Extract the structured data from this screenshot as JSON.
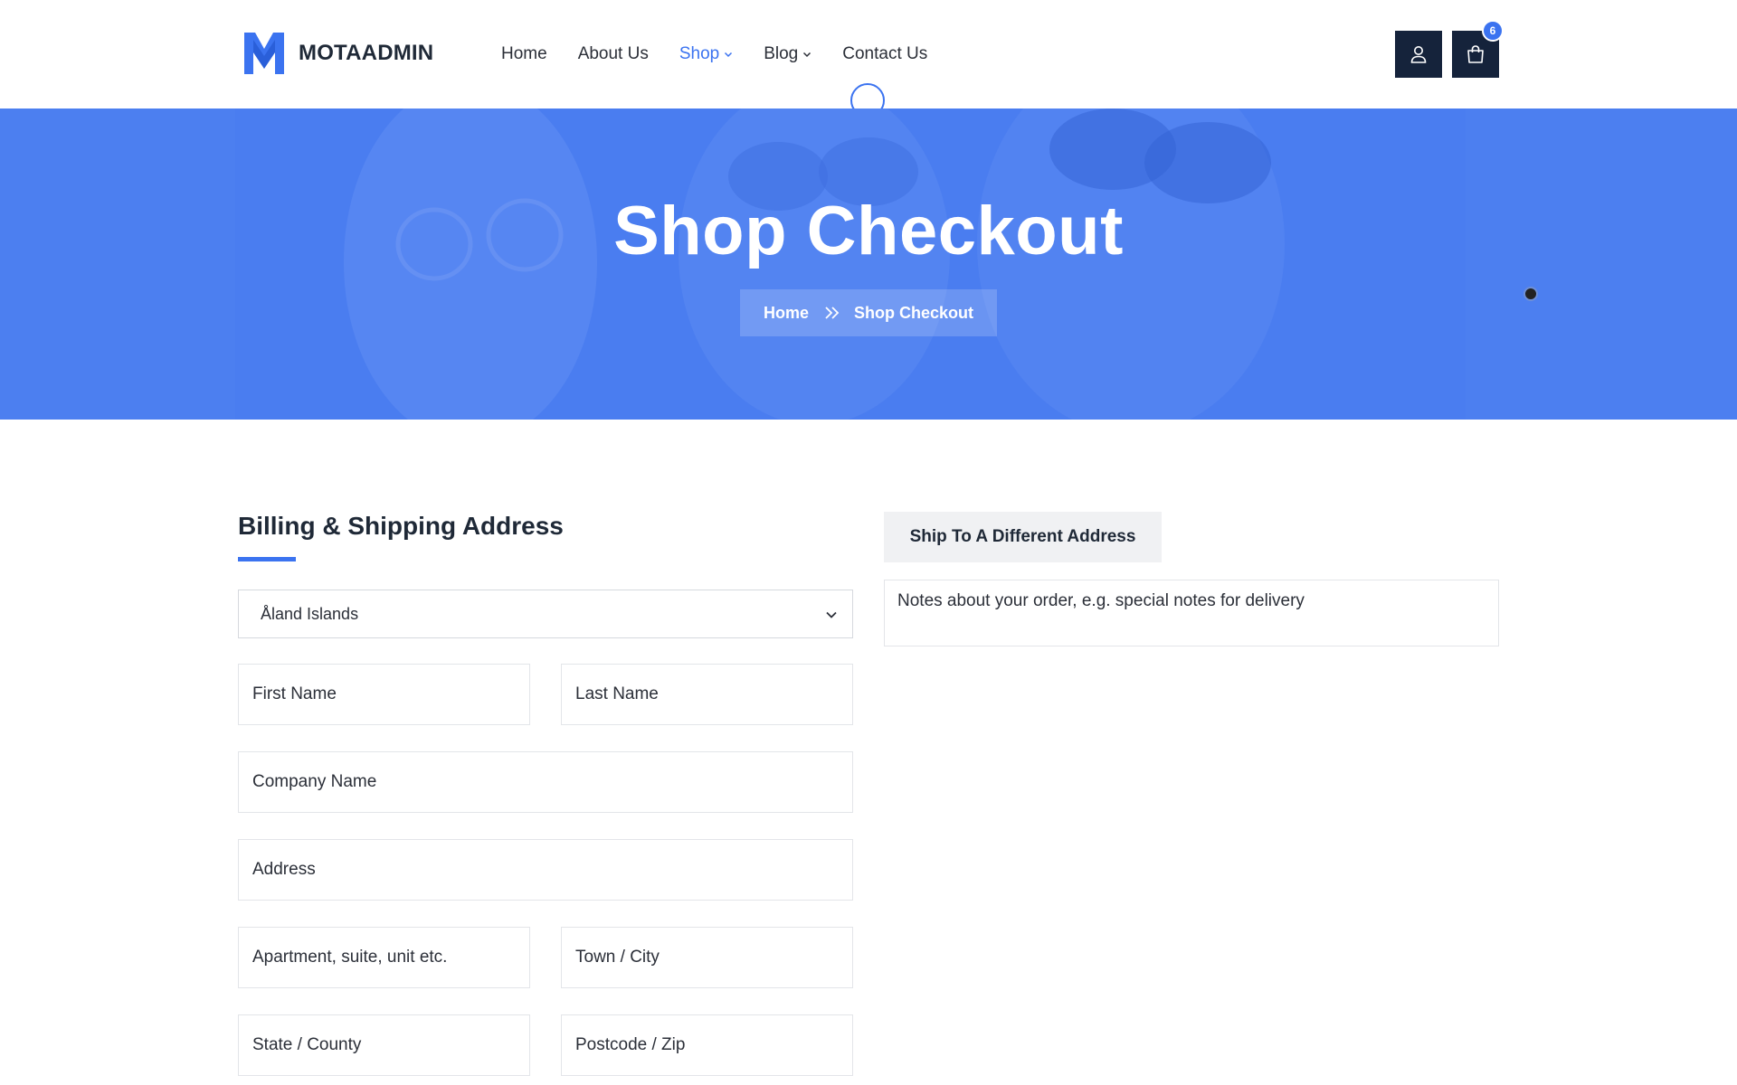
{
  "brand": {
    "name": "MOTAADMIN",
    "logo_icon": "m-logo-icon",
    "accent_color": "#3b73f0"
  },
  "nav": {
    "items": [
      {
        "label": "Home",
        "has_dropdown": false,
        "active": false
      },
      {
        "label": "About Us",
        "has_dropdown": false,
        "active": false
      },
      {
        "label": "Shop",
        "has_dropdown": true,
        "active": true
      },
      {
        "label": "Blog",
        "has_dropdown": true,
        "active": false
      },
      {
        "label": "Contact Us",
        "has_dropdown": false,
        "active": false
      }
    ]
  },
  "header_actions": {
    "user_icon": "user-icon",
    "cart_icon": "shopping-bag-icon",
    "cart_count": "6"
  },
  "hero": {
    "title": "Shop Checkout",
    "breadcrumb": {
      "home": "Home",
      "separator_icon": "double-chevron-right-icon",
      "current": "Shop Checkout"
    }
  },
  "billing": {
    "heading": "Billing & Shipping Address",
    "country_select": {
      "value": "Åland Islands",
      "icon": "chevron-down-icon"
    },
    "fields": {
      "first_name": "First Name",
      "last_name": "Last Name",
      "company": "Company Name",
      "address": "Address",
      "apartment": "Apartment, suite, unit etc.",
      "town": "Town / City",
      "state": "State / County",
      "postcode": "Postcode / Zip"
    }
  },
  "shipping": {
    "different_address_label": "Ship To A Different Address",
    "notes_placeholder": "Notes about your order, e.g. special notes for delivery"
  }
}
